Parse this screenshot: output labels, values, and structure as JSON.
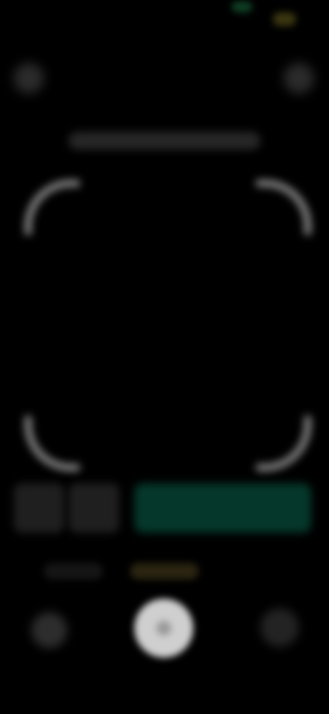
{
  "screen": {
    "type": "camera-scanner",
    "background": "#000000"
  },
  "status_bar": {
    "time": "",
    "indicator_green": "#0f3f24",
    "indicator_yellow": "#3a3510"
  },
  "top_controls": {
    "left_icon": "close-icon",
    "right_icon": "flash-icon"
  },
  "hint": {
    "text": ""
  },
  "scan_frame": {
    "corner_color": "#8a8a8a"
  },
  "actions": {
    "button_a_icon": "gallery-icon",
    "button_b_icon": "settings-icon",
    "primary_label": "",
    "primary_color": "#05372a"
  },
  "modes": {
    "items": [
      "",
      ""
    ],
    "active_index": 1,
    "active_color": "#7a6a20"
  },
  "bottom_controls": {
    "left_icon": "thumbnail-icon",
    "shutter_icon": "shutter-icon",
    "right_icon": "switch-camera-icon"
  }
}
